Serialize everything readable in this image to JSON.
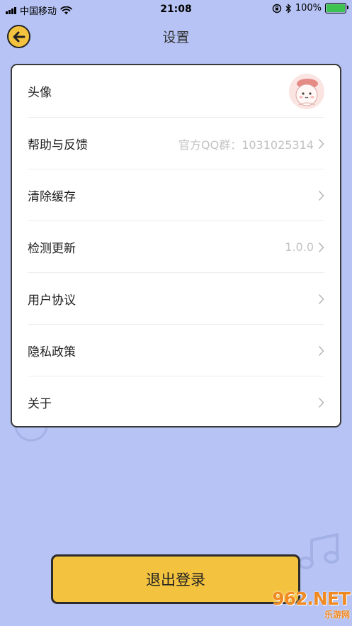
{
  "status_bar": {
    "carrier": "中国移动",
    "time": "21:08",
    "battery": "100%",
    "battery_level": 1.0
  },
  "header": {
    "title": "设置"
  },
  "settings": {
    "avatar_label": "头像",
    "help_label": "帮助与反馈",
    "help_value": "官方QQ群：1031025314",
    "clear_cache_label": "清除缓存",
    "check_update_label": "检测更新",
    "check_update_value": "1.0.0",
    "user_agreement_label": "用户协议",
    "privacy_policy_label": "隐私政策",
    "about_label": "关于"
  },
  "logout_label": "退出登录",
  "watermark": {
    "number": "962.NET",
    "sub": "乐游网"
  },
  "colors": {
    "background": "#b6c3f4",
    "accent": "#f3c33f",
    "card": "#ffffff",
    "muted_text": "#c2c2c2"
  }
}
